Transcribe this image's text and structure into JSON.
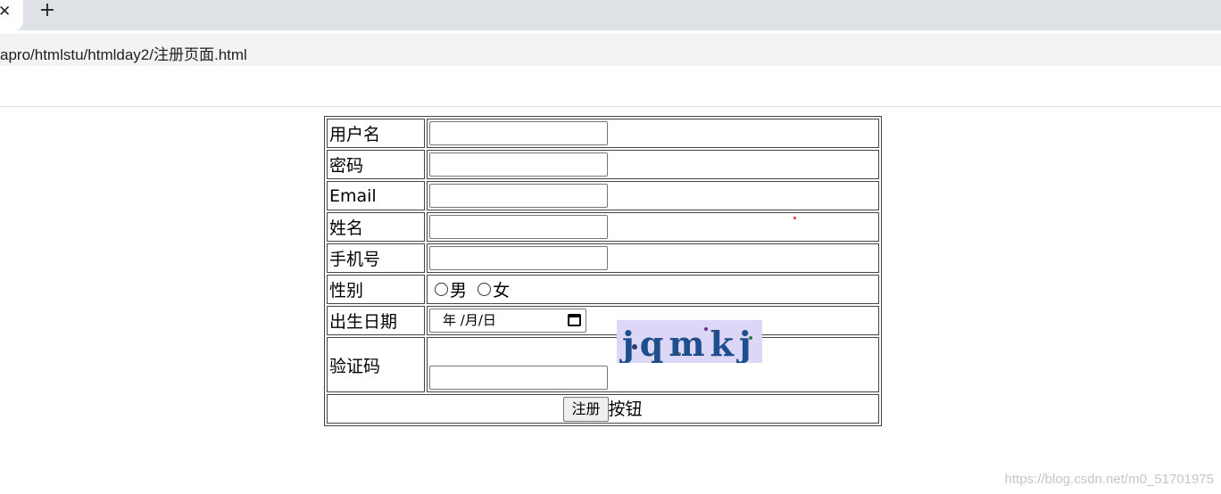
{
  "browser": {
    "tab_close_glyph": "✕",
    "new_tab_glyph": "+",
    "address": "apro/htmlstu/htmlday2/注册页面.html"
  },
  "form": {
    "username_label": "用户名",
    "password_label": "密码",
    "email_label": "Email",
    "name_label": "姓名",
    "phone_label": "手机号",
    "gender_label": "性别",
    "gender_male": "男",
    "gender_female": "女",
    "birthday_label": "出生日期",
    "birthday_placeholder": "年 /月/日",
    "captcha_label": "验证码",
    "captcha_text": "jqmkj",
    "submit_label": "注册",
    "submit_suffix": "按钮"
  },
  "watermark": "https://blog.csdn.net/m0_51701975"
}
